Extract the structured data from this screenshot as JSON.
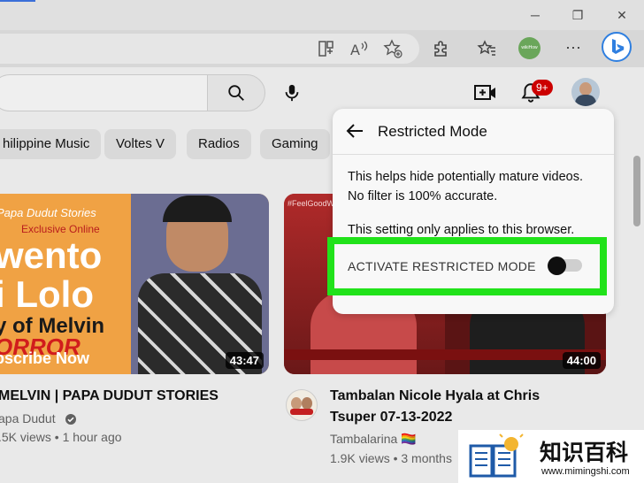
{
  "browser": {
    "window_controls": {
      "minimize": "─",
      "restore": "❐",
      "close": "✕"
    },
    "toolbar_icons": [
      "split-screen-icon",
      "read-aloud-icon",
      "add-favorite-icon",
      "extensions-icon",
      "favorites-icon",
      "more-icon"
    ],
    "more_label": "···",
    "profile_text": "wikiHow",
    "accent_color": "#3b6fd8"
  },
  "youtube": {
    "notification_badge": "9+",
    "chips": [
      "hilippine Music",
      "Voltes V",
      "Radios",
      "Gaming"
    ],
    "videos": [
      {
        "thumb_lines": [
          "Papa Dudut Stories",
          "Exclusive Online",
          "wento",
          "i Lolo",
          "y of Melvin",
          "ORROR",
          "bscribe Now"
        ],
        "duration": "43:47",
        "title": "MELVIN | PAPA DUDUT STORIES",
        "channel": "apa Dudut",
        "meta": ".5K views • 1 hour ago"
      },
      {
        "thumb_tag": "#FeelGoodW",
        "duration": "44:00",
        "title_line1": "Tambalan Nicole Hyala at Chris",
        "title_line2": "Tsuper 07-13-2022",
        "channel": "Tambalarina 🏳️‍🌈",
        "meta": "1.9K views • 3 months"
      }
    ],
    "restricted_panel": {
      "title": "Restricted Mode",
      "desc1": "This helps hide potentially mature videos.",
      "desc2": "No filter is 100% accurate.",
      "desc3": "This setting only applies to this browser.",
      "toggle_label": "ACTIVATE RESTRICTED MODE",
      "toggle_on": false,
      "highlight_color": "#21e21a"
    }
  },
  "watermark": {
    "cn": "知识百科",
    "url": "www.mimingshi.com"
  }
}
